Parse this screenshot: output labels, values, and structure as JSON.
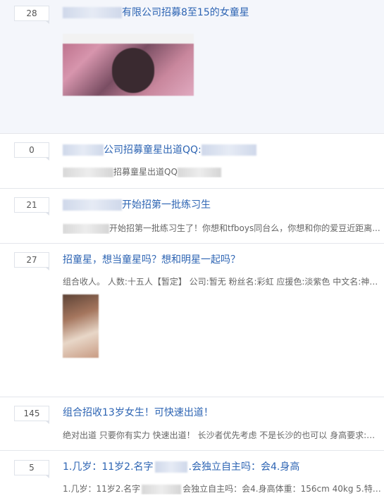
{
  "threads": [
    {
      "count": "28",
      "title": "有限公司招募8至15的女童星"
    },
    {
      "count": "0",
      "title": "公司招募童星出道QQ:",
      "snippet": "招募童星出道QQ"
    },
    {
      "count": "21",
      "title": "开始招第一批练习生",
      "snippet": "开始招第一批练习生了！你想和tfboys同台么，你想和你的爱豆近距离..."
    },
    {
      "count": "27",
      "title": "招童星，想当童星吗？想和明星一起吗？",
      "snippet": "组合收人。 人数:十五人【暂定】 公司:暂无 粉丝名:彩虹 应援色:淡紫色 中文名:神秘..."
    },
    {
      "count": "145",
      "title": "组合招收13岁女生！可快速出道！",
      "snippet": "绝对出道 只要你有实力 快速出道！ 长沙者优先考虑 不是长沙的也可以 身高要求:薏..."
    },
    {
      "count": "5",
      "title_a": "1.几岁：11岁2.名字",
      "title_b": ".会独立自主吗：会4.身高",
      "snippet_a": "1.几岁：11岁2.名字",
      "snippet_b": "会独立自主吗：会4.身高体重：156cm 40kg 5.特长..."
    }
  ],
  "colors": {
    "link": "#2d64b3",
    "text": "#666666",
    "count_border": "#dfe3ea",
    "highlight_bg": "#f4f6fb"
  }
}
